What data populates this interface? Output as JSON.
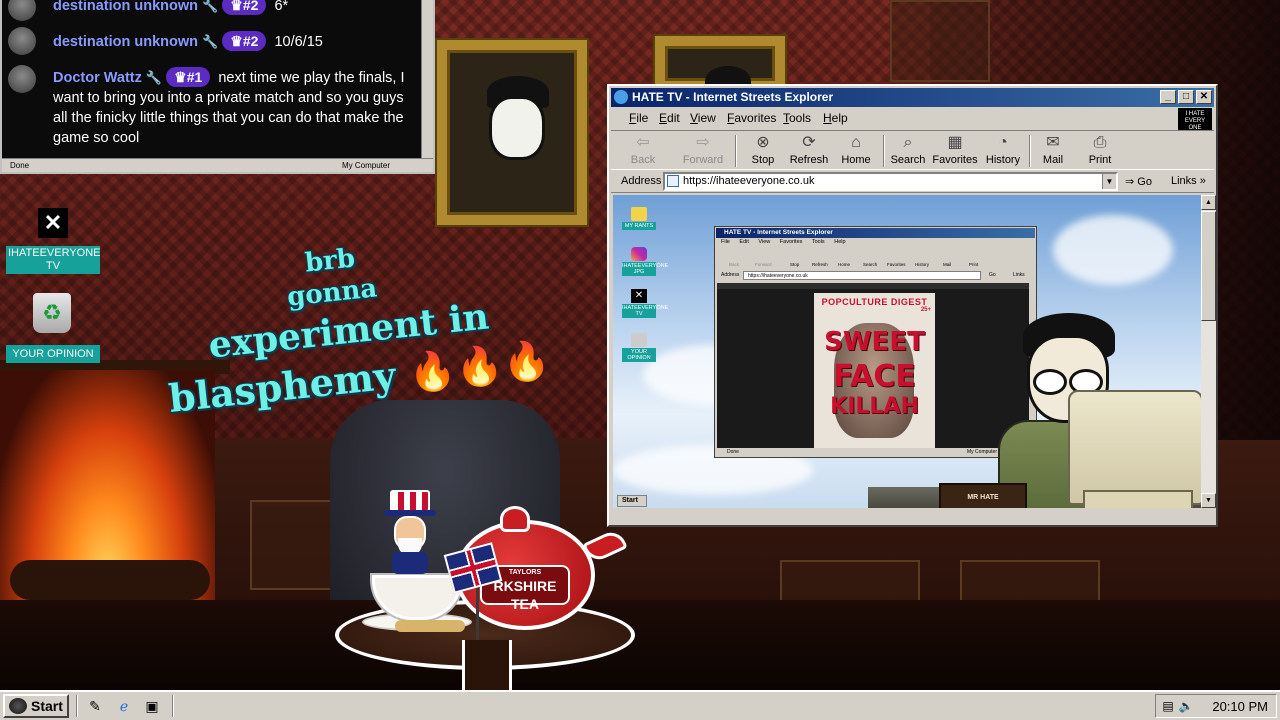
{
  "chat": {
    "messages": [
      {
        "user": "destination unknown",
        "badge": "#2",
        "text": "6*"
      },
      {
        "user": "destination unknown",
        "badge": "#2",
        "text": "10/6/15"
      },
      {
        "user": "Doctor Wattz",
        "badge": "#1",
        "text": "next time we play the finals, I want to bring you into a private match and so you guys all the finicky little things that you can do that make the game so cool"
      }
    ],
    "status_left": "Done",
    "status_right": "My Computer"
  },
  "desktop_icons": [
    {
      "label": "IHATEEVERYONE TV",
      "icon": "x-icon"
    },
    {
      "label": "YOUR OPINION",
      "icon": "recycle-bin-icon"
    }
  ],
  "overlay_text": [
    "brb",
    "gonna",
    "experiment in",
    "blasphemy"
  ],
  "overlay_emoji": "fire",
  "tea": {
    "label_top": "TAYLORS",
    "label_main": "RKSHIRE",
    "label_bottom": "TEA"
  },
  "ie_window": {
    "title": "HATE TV - Internet Streets Explorer",
    "menu": [
      "File",
      "Edit",
      "View",
      "Favorites",
      "Tools",
      "Help"
    ],
    "toolbar": [
      {
        "label": "Back",
        "icon": "back-arrow-icon",
        "enabled": false
      },
      {
        "label": "Forward",
        "icon": "forward-arrow-icon",
        "enabled": false
      },
      {
        "label": "Stop",
        "icon": "stop-icon",
        "enabled": true
      },
      {
        "label": "Refresh",
        "icon": "refresh-icon",
        "enabled": true
      },
      {
        "label": "Home",
        "icon": "home-icon",
        "enabled": true
      },
      {
        "label": "Search",
        "icon": "search-icon",
        "enabled": true
      },
      {
        "label": "Favorites",
        "icon": "favorites-icon",
        "enabled": true
      },
      {
        "label": "History",
        "icon": "history-icon",
        "enabled": true
      },
      {
        "label": "Mail",
        "icon": "mail-icon",
        "enabled": true
      },
      {
        "label": "Print",
        "icon": "print-icon",
        "enabled": true
      }
    ],
    "address_label": "Address",
    "address_value": "https://ihateeveryone.co.uk",
    "go_label": "Go",
    "links_label": "Links",
    "inner_desktop_icons": [
      {
        "label": "MY RANTS",
        "icon": "folder-icon"
      },
      {
        "label": "IHATEEVERYONE JPG",
        "icon": "instagram-icon"
      },
      {
        "label": "IHATEEVERYONE TV",
        "icon": "x-icon"
      },
      {
        "label": "YOUR OPINION",
        "icon": "recycle-bin-icon"
      }
    ],
    "nested_window": {
      "title": "HATE TV - Internet Streets Explorer",
      "menu": [
        "File",
        "Edit",
        "View",
        "Favorites",
        "Tools",
        "Help"
      ],
      "toolbar": [
        "Back",
        "Forward",
        "Stop",
        "Refresh",
        "Home",
        "Search",
        "Favorites",
        "History",
        "Mail",
        "Print"
      ],
      "address_label": "Address",
      "address_value": "https://ihateeveryone.co.uk",
      "go_label": "Go",
      "links_label": "Links",
      "status_left": "Done",
      "status_right": "My Computer",
      "magazine": {
        "header": "POPCULTURE DIGEST",
        "age": "25+",
        "line1": "SWEET",
        "line2": "FACE",
        "line3": "KILLAH"
      }
    },
    "nameplate": "MR HATE",
    "inner_start_label": "Start"
  },
  "taskbar": {
    "start_label": "Start",
    "clock": "20:10 PM"
  }
}
